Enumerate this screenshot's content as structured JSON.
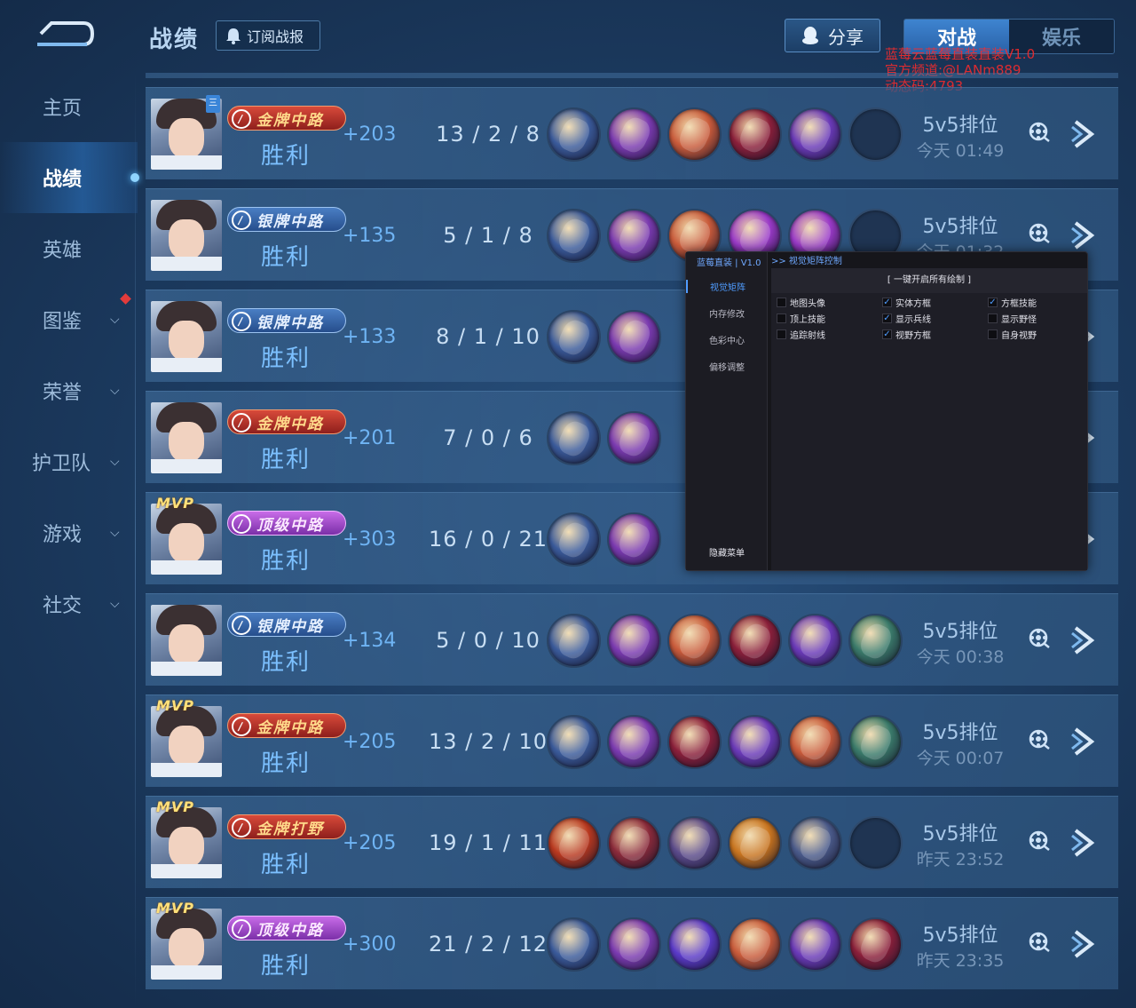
{
  "header": {
    "title": "战绩",
    "subscribe_label": "订阅战报",
    "share_label": "分享",
    "tabs": [
      {
        "label": "对战",
        "active": true
      },
      {
        "label": "娱乐",
        "active": false
      }
    ]
  },
  "watermark": {
    "line1": "蓝莓云蓝莓直装直装V1.0",
    "line2": "官方频道:@LANm889",
    "line3": "动态码:4793"
  },
  "sidebar": {
    "items": [
      {
        "label": "主页",
        "has_chevron": false,
        "active": false
      },
      {
        "label": "战绩",
        "has_chevron": false,
        "active": true
      },
      {
        "label": "英雄",
        "has_chevron": false,
        "active": false
      },
      {
        "label": "图鉴",
        "has_chevron": true,
        "active": false
      },
      {
        "label": "荣誉",
        "has_chevron": true,
        "active": false
      },
      {
        "label": "护卫队",
        "has_chevron": true,
        "active": false
      },
      {
        "label": "游戏",
        "has_chevron": true,
        "active": false
      },
      {
        "label": "社交",
        "has_chevron": true,
        "active": false
      }
    ]
  },
  "matches": [
    {
      "mvp": false,
      "rank_tag": "三",
      "role": "金牌中路",
      "role_style": "gold",
      "result": "胜利",
      "score": "+203",
      "kda": "13 / 2 / 8",
      "mode": "5v5排位",
      "time": "今天 01:49",
      "items": [
        "#3a5a9a",
        "#7a3ab0",
        "#c85a3a",
        "#8a1f3a",
        "#6a3ab8",
        ""
      ]
    },
    {
      "mvp": false,
      "rank_tag": "",
      "role": "银牌中路",
      "role_style": "silver",
      "result": "胜利",
      "score": "+135",
      "kda": "5 / 1 / 8",
      "mode": "5v5排位",
      "time": "今天 01:32",
      "items": [
        "#3a5a9a",
        "#7a3ab0",
        "#c85a3a",
        "#9a3ac8",
        "#9a3ac8",
        ""
      ]
    },
    {
      "mvp": false,
      "rank_tag": "",
      "role": "银牌中路",
      "role_style": "silver",
      "result": "胜利",
      "score": "+133",
      "kda": "8 / 1 / 10",
      "mode": "",
      "time": "",
      "items": [
        "#3a5a9a",
        "#7a3ab0"
      ]
    },
    {
      "mvp": false,
      "rank_tag": "",
      "role": "金牌中路",
      "role_style": "gold",
      "result": "胜利",
      "score": "+201",
      "kda": "7 / 0 / 6",
      "mode": "",
      "time": "",
      "items": [
        "#3a5a9a",
        "#7a3ab0"
      ]
    },
    {
      "mvp": true,
      "rank_tag": "",
      "role": "顶级中路",
      "role_style": "top",
      "result": "胜利",
      "score": "+303",
      "kda": "16 / 0 / 21",
      "mode": "",
      "time": "",
      "items": [
        "#3a5a9a",
        "#7a3ab0"
      ]
    },
    {
      "mvp": false,
      "rank_tag": "",
      "role": "银牌中路",
      "role_style": "silver",
      "result": "胜利",
      "score": "+134",
      "kda": "5 / 0 / 10",
      "mode": "5v5排位",
      "time": "今天 00:38",
      "items": [
        "#3a5a9a",
        "#7a3ab0",
        "#c85a3a",
        "#8a1f3a",
        "#6a3ab8",
        "#3a7a6a"
      ]
    },
    {
      "mvp": true,
      "rank_tag": "",
      "role": "金牌中路",
      "role_style": "gold",
      "result": "胜利",
      "score": "+205",
      "kda": "13 / 2 / 10",
      "mode": "5v5排位",
      "time": "今天 00:07",
      "items": [
        "#3a5a9a",
        "#7a3ab0",
        "#8a1f3a",
        "#6a3ab8",
        "#c85a3a",
        "#3a7a6a"
      ]
    },
    {
      "mvp": true,
      "rank_tag": "",
      "role": "金牌打野",
      "role_style": "gold",
      "result": "胜利",
      "score": "+205",
      "kda": "19 / 1 / 11",
      "mode": "5v5排位",
      "time": "昨天 23:52",
      "items": [
        "#b8381f",
        "#8a2a3a",
        "#5a4a8a",
        "#c8741f",
        "#4a5a8a",
        ""
      ]
    },
    {
      "mvp": true,
      "rank_tag": "",
      "role": "顶级中路",
      "role_style": "top",
      "result": "胜利",
      "score": "+300",
      "kda": "21 / 2 / 12",
      "mode": "5v5排位",
      "time": "昨天 23:35",
      "items": [
        "#3a5a9a",
        "#7a3ab0",
        "#5a3ac8",
        "#c85a3a",
        "#6a3ab8",
        "#8a1f3a"
      ]
    }
  ],
  "overlay_menu": {
    "brand": "蓝莓直装 | V1.0",
    "breadcrumb": ">> 视觉矩阵控制",
    "nav": [
      {
        "label": "视觉矩阵",
        "active": true
      },
      {
        "label": "内存修改",
        "active": false
      },
      {
        "label": "色彩中心",
        "active": false
      },
      {
        "label": "偏移调整",
        "active": false
      }
    ],
    "hide_label": "隐藏菜单",
    "enable_all_label": "[ 一键开启所有绘制 ]",
    "options": [
      {
        "label": "地图头像",
        "checked": false
      },
      {
        "label": "实体方框",
        "checked": true
      },
      {
        "label": "方框技能",
        "checked": true
      },
      {
        "label": "顶上技能",
        "checked": false
      },
      {
        "label": "显示兵线",
        "checked": true
      },
      {
        "label": "显示野怪",
        "checked": false
      },
      {
        "label": "追踪射线",
        "checked": false
      },
      {
        "label": "视野方框",
        "checked": true
      },
      {
        "label": "自身视野",
        "checked": false
      }
    ]
  }
}
